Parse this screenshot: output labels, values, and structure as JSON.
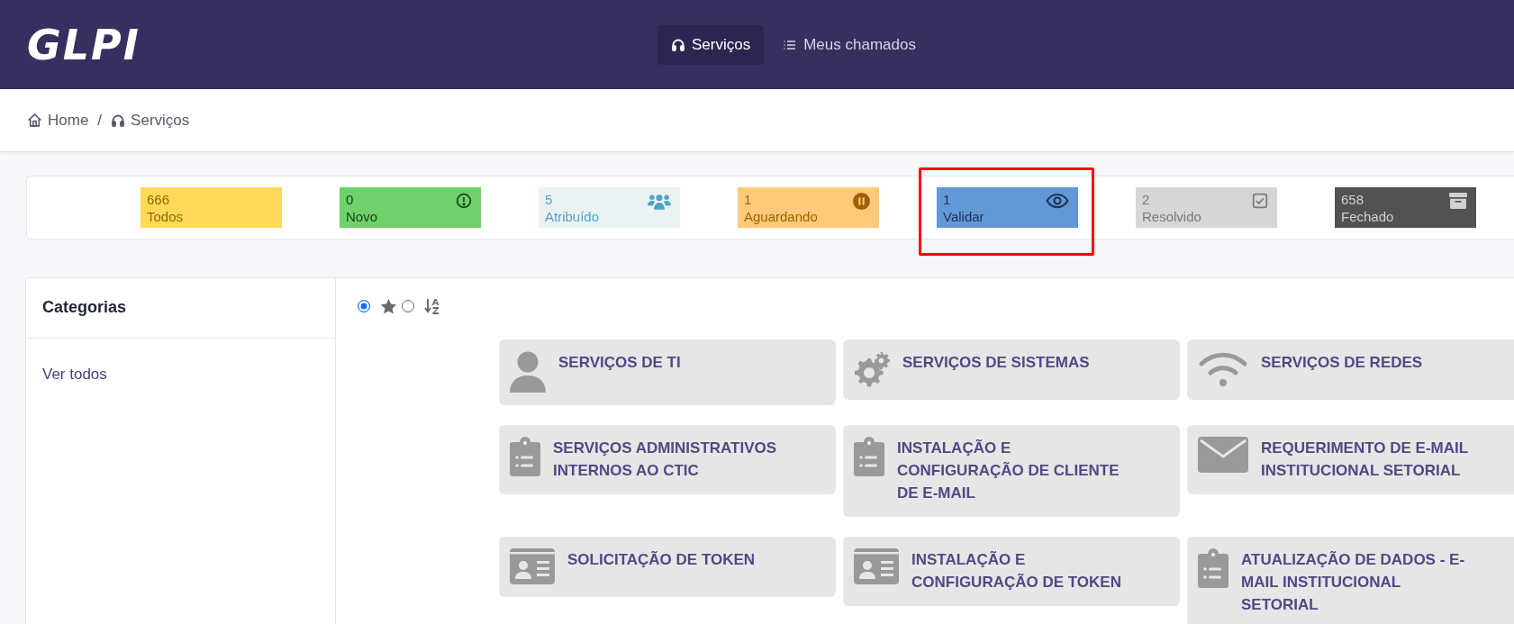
{
  "header": {
    "logo": "GLPI",
    "nav": [
      {
        "label": "Serviços",
        "kind": "headset",
        "selected": true
      },
      {
        "label": "Meus chamados",
        "kind": "list",
        "selected": false
      }
    ]
  },
  "breadcrumb": [
    {
      "label": "Home",
      "kind": "home"
    },
    {
      "separator": "/",
      "label": "Serviços",
      "kind": "headset"
    }
  ],
  "counters": [
    {
      "value": "666",
      "label": "Todos",
      "kind": "all",
      "color": "#ffd957",
      "highlighted": false
    },
    {
      "value": "0",
      "label": "Novo",
      "kind": "new",
      "color": "#6ed16b",
      "highlighted": false
    },
    {
      "value": "5",
      "label": "Atribuído",
      "kind": "assigned",
      "color": "#eaf2f4",
      "highlighted": false
    },
    {
      "value": "1",
      "label": "Aguardando",
      "kind": "waiting",
      "color": "#ffc97b",
      "highlighted": false
    },
    {
      "value": "1",
      "label": "Validar",
      "kind": "validate",
      "color": "#6298d6",
      "highlighted": true
    },
    {
      "value": "2",
      "label": "Resolvido",
      "kind": "solved",
      "color": "#d6d6d6",
      "highlighted": false
    },
    {
      "value": "658",
      "label": "Fechado",
      "kind": "closed",
      "color": "#525252",
      "highlighted": false
    }
  ],
  "categories": {
    "title": "Categorias",
    "items": [
      {
        "label": "Ver todos"
      }
    ]
  },
  "sort_options": [
    {
      "kind": "favorites",
      "selected": true
    },
    {
      "kind": "alphabetical",
      "selected": false
    }
  ],
  "services": [
    {
      "title": "SERVIÇOS DE TI",
      "kind": "user"
    },
    {
      "title": "SERVIÇOS DE SISTEMAS",
      "kind": "gears"
    },
    {
      "title": "SERVIÇOS DE REDES",
      "kind": "wifi"
    },
    {
      "title": "SERVIÇOS ADMINISTRATIVOS INTERNOS AO CTIC",
      "kind": "clipboard"
    },
    {
      "title": "INSTALAÇÃO E CONFIGURAÇÃO DE CLIENTE DE E-MAIL",
      "kind": "clipboard"
    },
    {
      "title": "REQUERIMENTO DE E-MAIL INSTITUCIONAL SETORIAL",
      "kind": "envelope"
    },
    {
      "title": "SOLICITAÇÃO DE TOKEN",
      "kind": "idcard"
    },
    {
      "title": "INSTALAÇÃO E CONFIGURAÇÃO DE TOKEN",
      "kind": "idcard"
    },
    {
      "title": "ATUALIZAÇÃO DE DADOS - E-MAIL INSTITUCIONAL SETORIAL",
      "kind": "clipboard"
    }
  ]
}
